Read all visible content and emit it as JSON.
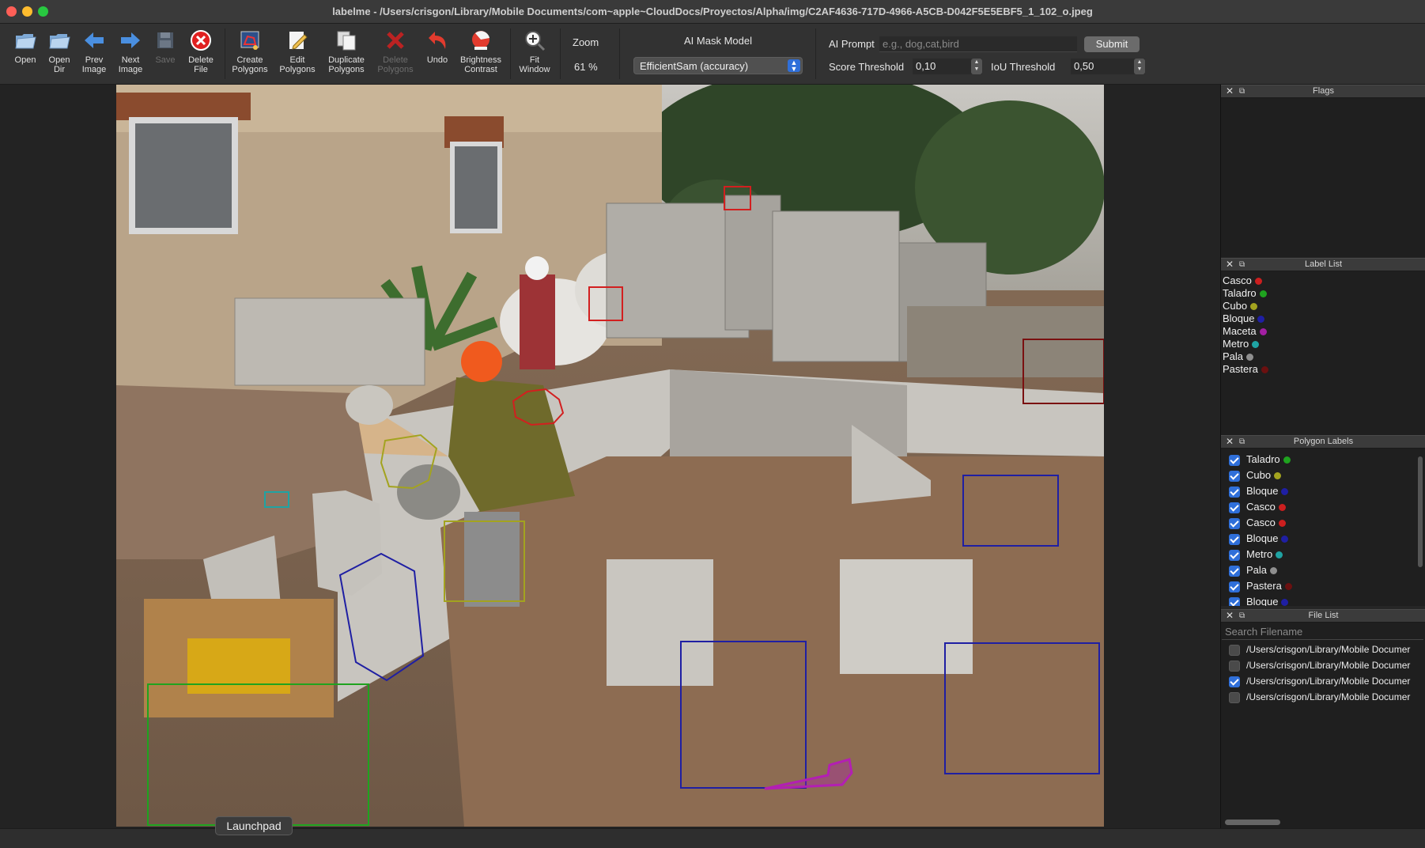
{
  "window": {
    "title": "labelme - /Users/crisgon/Library/Mobile Documents/com~apple~CloudDocs/Proyectos/Alpha/img/C2AF4636-717D-4966-A5CB-D042F5E5EBF5_1_102_o.jpeg",
    "traffic_lights": [
      "#ff5f57",
      "#febc2e",
      "#28c840"
    ]
  },
  "toolbar": {
    "open": "Open",
    "open_dir": [
      "Open",
      "Dir"
    ],
    "prev_image": [
      "Prev",
      "Image"
    ],
    "next_image": [
      "Next",
      "Image"
    ],
    "save": "Save",
    "delete_file": [
      "Delete",
      "File"
    ],
    "create_polygons": [
      "Create",
      "Polygons"
    ],
    "edit_polygons": [
      "Edit",
      "Polygons"
    ],
    "duplicate_polygons": [
      "Duplicate",
      "Polygons"
    ],
    "delete_polygons": [
      "Delete",
      "Polygons"
    ],
    "undo": "Undo",
    "brightness_contrast": [
      "Brightness",
      "Contrast"
    ],
    "fit_window": [
      "Fit",
      "Window"
    ],
    "zoom_label": "Zoom",
    "zoom_value": "61 %",
    "ai_mask_model_label": "AI Mask Model",
    "ai_mask_model_value": "EfficientSam (accuracy)",
    "ai_prompt_label": "AI Prompt",
    "ai_prompt_placeholder": "e.g., dog,cat,bird",
    "submit": "Submit",
    "score_threshold_label": "Score Threshold",
    "score_threshold_value": "0,10",
    "iou_threshold_label": "IoU Threshold",
    "iou_threshold_value": "0,50"
  },
  "canvas": {
    "annotations": [
      {
        "label": "Taladro",
        "color": "#1fa31f"
      },
      {
        "label": "Cubo",
        "color": "#a3a31f"
      },
      {
        "label": "Bloque",
        "color": "#1f1fa3"
      },
      {
        "label": "Casco",
        "color": "#d21f1f"
      },
      {
        "label": "Metro",
        "color": "#1fa3a3"
      },
      {
        "label": "Maceta",
        "color": "#b31fb3"
      },
      {
        "label": "Pastera",
        "color": "#7a1010"
      }
    ]
  },
  "dock": {
    "flags_title": "Flags",
    "label_list_title": "Label List",
    "labels": [
      {
        "name": "Casco",
        "color": "#cc1f1f"
      },
      {
        "name": "Taladro",
        "color": "#1fa31f"
      },
      {
        "name": "Cubo",
        "color": "#a3a31f"
      },
      {
        "name": "Bloque",
        "color": "#1f1fa3"
      },
      {
        "name": "Maceta",
        "color": "#a31fa3"
      },
      {
        "name": "Metro",
        "color": "#1fa3a3"
      },
      {
        "name": "Pala",
        "color": "#8f8f8f"
      },
      {
        "name": "Pastera",
        "color": "#6b1010"
      }
    ],
    "polygon_labels_title": "Polygon Labels",
    "polygon_labels": [
      {
        "name": "Taladro",
        "color": "#1fa31f"
      },
      {
        "name": "Cubo",
        "color": "#a3a31f"
      },
      {
        "name": "Bloque",
        "color": "#1f1fa3"
      },
      {
        "name": "Casco",
        "color": "#cc1f1f"
      },
      {
        "name": "Casco",
        "color": "#cc1f1f"
      },
      {
        "name": "Bloque",
        "color": "#1f1fa3"
      },
      {
        "name": "Metro",
        "color": "#1fa3a3"
      },
      {
        "name": "Pala",
        "color": "#8f8f8f"
      },
      {
        "name": "Pastera",
        "color": "#6b1010"
      },
      {
        "name": "Bloque",
        "color": "#1f1fa3"
      }
    ],
    "file_list_title": "File List",
    "search_placeholder": "Search Filename",
    "files": [
      {
        "path": "/Users/crisgon/Library/Mobile Documer",
        "checked": false
      },
      {
        "path": "/Users/crisgon/Library/Mobile Documer",
        "checked": false
      },
      {
        "path": "/Users/crisgon/Library/Mobile Documer",
        "checked": true
      },
      {
        "path": "/Users/crisgon/Library/Mobile Documer",
        "checked": false
      }
    ]
  },
  "tooltip": "Launchpad"
}
